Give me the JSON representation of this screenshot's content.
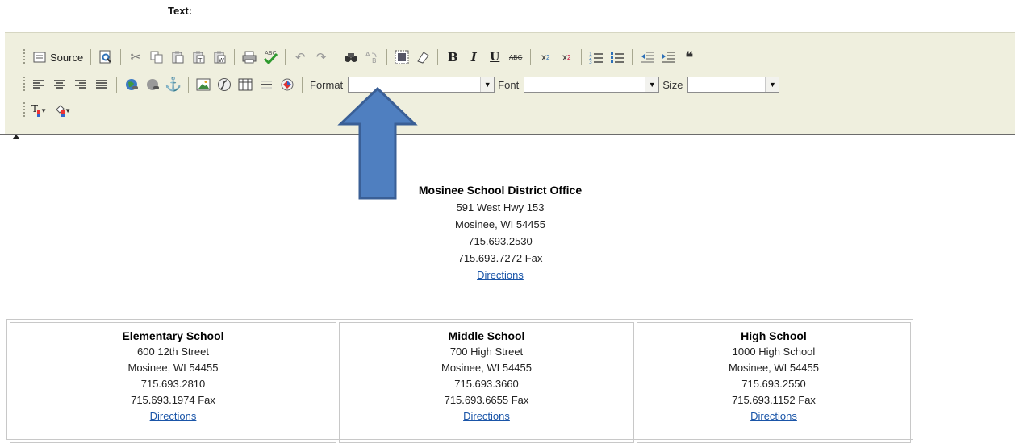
{
  "field": {
    "label": "Text:"
  },
  "toolbar": {
    "source_label": "Source",
    "format": {
      "label": "Format",
      "value": ""
    },
    "font": {
      "label": "Font",
      "value": ""
    },
    "size": {
      "label": "Size",
      "value": ""
    },
    "icons": [
      "source-icon",
      "preview-icon",
      "cut-icon",
      "copy-icon",
      "paste-icon",
      "paste-text-icon",
      "paste-word-icon",
      "print-icon",
      "spellcheck-icon",
      "undo-icon",
      "redo-icon",
      "find-icon",
      "replace-icon",
      "select-all-icon",
      "remove-format-icon",
      "bold-icon",
      "italic-icon",
      "underline-icon",
      "strikethrough-icon",
      "subscript-icon",
      "superscript-icon",
      "ordered-list-icon",
      "unordered-list-icon",
      "outdent-icon",
      "indent-icon",
      "blockquote-icon",
      "align-left-icon",
      "align-center-icon",
      "align-right-icon",
      "justify-icon",
      "link-icon",
      "unlink-icon",
      "anchor-icon",
      "image-icon",
      "flash-icon",
      "table-icon",
      "horizontal-rule-icon",
      "special-char-icon",
      "text-color-icon",
      "background-color-icon"
    ],
    "accent_color": "#efefde"
  },
  "office": {
    "title": "Mosinee School District Office",
    "address": "591 West Hwy 153",
    "city": "Mosinee, WI 54455",
    "phone": "715.693.2530",
    "fax": "715.693.7272 Fax",
    "link": "Directions"
  },
  "schools": [
    {
      "name": "Elementary School",
      "address": "600 12th Street",
      "city": "Mosinee, WI 54455",
      "phone": "715.693.2810",
      "fax": "715.693.1974 Fax",
      "link": "Directions"
    },
    {
      "name": "Middle School",
      "address": "700 High Street",
      "city": "Mosinee, WI 54455",
      "phone": "715.693.3660",
      "fax": "715.693.6655 Fax",
      "link": "Directions"
    },
    {
      "name": "High School",
      "address": "1000 High School",
      "city": "Mosinee, WI 54455",
      "phone": "715.693.2550",
      "fax": "715.693.1152 Fax",
      "link": "Directions"
    }
  ],
  "overlay": {
    "arrow_color": "#4f7fc0",
    "arrow_stroke": "#3a5f96"
  }
}
